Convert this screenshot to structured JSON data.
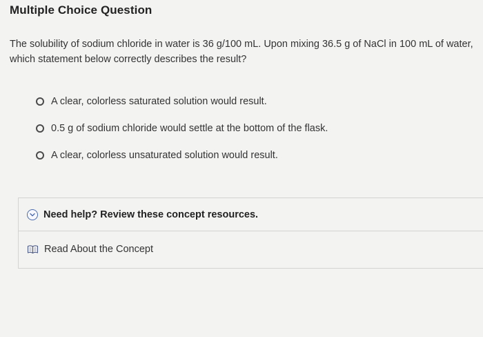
{
  "header": {
    "title": "Multiple Choice Question"
  },
  "question": {
    "text": "The solubility of sodium chloride in water is 36 g/100 mL. Upon mixing 36.5 g of NaCl in 100 mL of water, which statement below correctly describes the result?"
  },
  "options": [
    {
      "label": "A clear, colorless saturated solution would result."
    },
    {
      "label": "0.5 g of sodium chloride would settle at the bottom of the flask."
    },
    {
      "label": "A clear, colorless unsaturated solution would result."
    }
  ],
  "help": {
    "title": "Need help? Review these concept resources.",
    "resource_label": "Read About the Concept",
    "icons": {
      "toggle": "chevron-down-icon",
      "resource": "book-icon"
    },
    "colors": {
      "toggle": "#4a6bb0"
    }
  }
}
